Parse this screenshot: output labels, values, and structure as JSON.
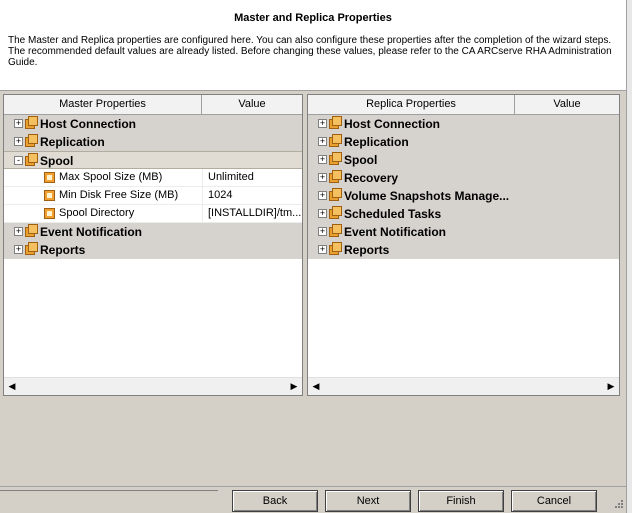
{
  "header": {
    "title": "Master and Replica Properties",
    "description": "The Master and Replica properties are configured here. You can also configure these properties after the completion of the wizard steps. The recommended default values are already listed. Before changing these values, please refer to the CA ARCserve RHA Administration Guide."
  },
  "master": {
    "col_name": "Master Properties",
    "col_value": "Value",
    "groups": [
      {
        "label": "Host Connection",
        "expander": "+"
      },
      {
        "label": "Replication",
        "expander": "+"
      },
      {
        "label": "Spool",
        "expander": "-"
      },
      {
        "label": "Event Notification",
        "expander": "+"
      },
      {
        "label": "Reports",
        "expander": "+"
      }
    ],
    "spool_items": [
      {
        "label": "Max Spool Size (MB)",
        "value": "Unlimited"
      },
      {
        "label": "Min Disk Free Size (MB)",
        "value": "1024"
      },
      {
        "label": "Spool Directory",
        "value": "[INSTALLDIR]/tm..."
      }
    ]
  },
  "replica": {
    "col_name": "Replica Properties",
    "col_value": "Value",
    "groups": [
      {
        "label": "Host Connection",
        "expander": "+"
      },
      {
        "label": "Replication",
        "expander": "+"
      },
      {
        "label": "Spool",
        "expander": "+"
      },
      {
        "label": "Recovery",
        "expander": "+"
      },
      {
        "label": "Volume Snapshots Manage...",
        "expander": "+"
      },
      {
        "label": "Scheduled Tasks",
        "expander": "+"
      },
      {
        "label": "Event Notification",
        "expander": "+"
      },
      {
        "label": "Reports",
        "expander": "+"
      }
    ]
  },
  "scroll": {
    "left_arrow": "◀",
    "right_arrow": "▶"
  },
  "buttons": {
    "back": "Back",
    "next": "Next",
    "finish": "Finish",
    "cancel": "Cancel"
  },
  "icons": {
    "group": "property-group-icon",
    "leaf": "property-item-icon",
    "grip": "resize-grip-icon"
  }
}
